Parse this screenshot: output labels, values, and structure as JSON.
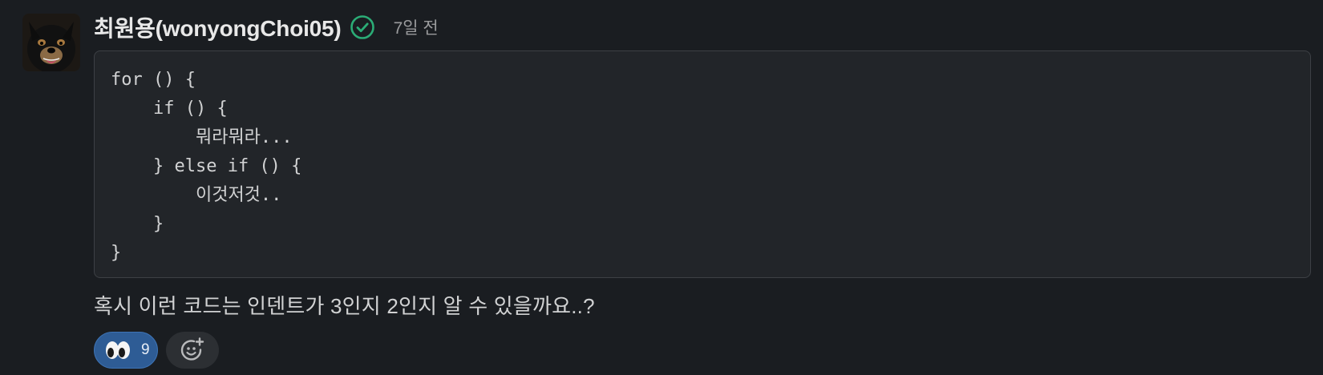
{
  "message": {
    "author": "최원용(wonyongChoi05)",
    "timestamp": "7일 전",
    "code_lines": [
      "for () {",
      "    if () {",
      "        뭐라뭐라...",
      "    } else if () {",
      "        이것저것..",
      "    }",
      "}"
    ],
    "text": "혹시 이런 코드는 인덴트가 3인지 2인지 알 수 있을까요..?"
  },
  "reactions": [
    {
      "emoji": "eyes-icon",
      "count": "9"
    }
  ],
  "icons": {
    "verified": "check-circle-icon",
    "add_reaction": "add-reaction-icon"
  },
  "colors": {
    "background": "#1a1d21",
    "code_background": "#222529",
    "verified": "#2bac76",
    "reaction_active": "#2e5c95"
  }
}
